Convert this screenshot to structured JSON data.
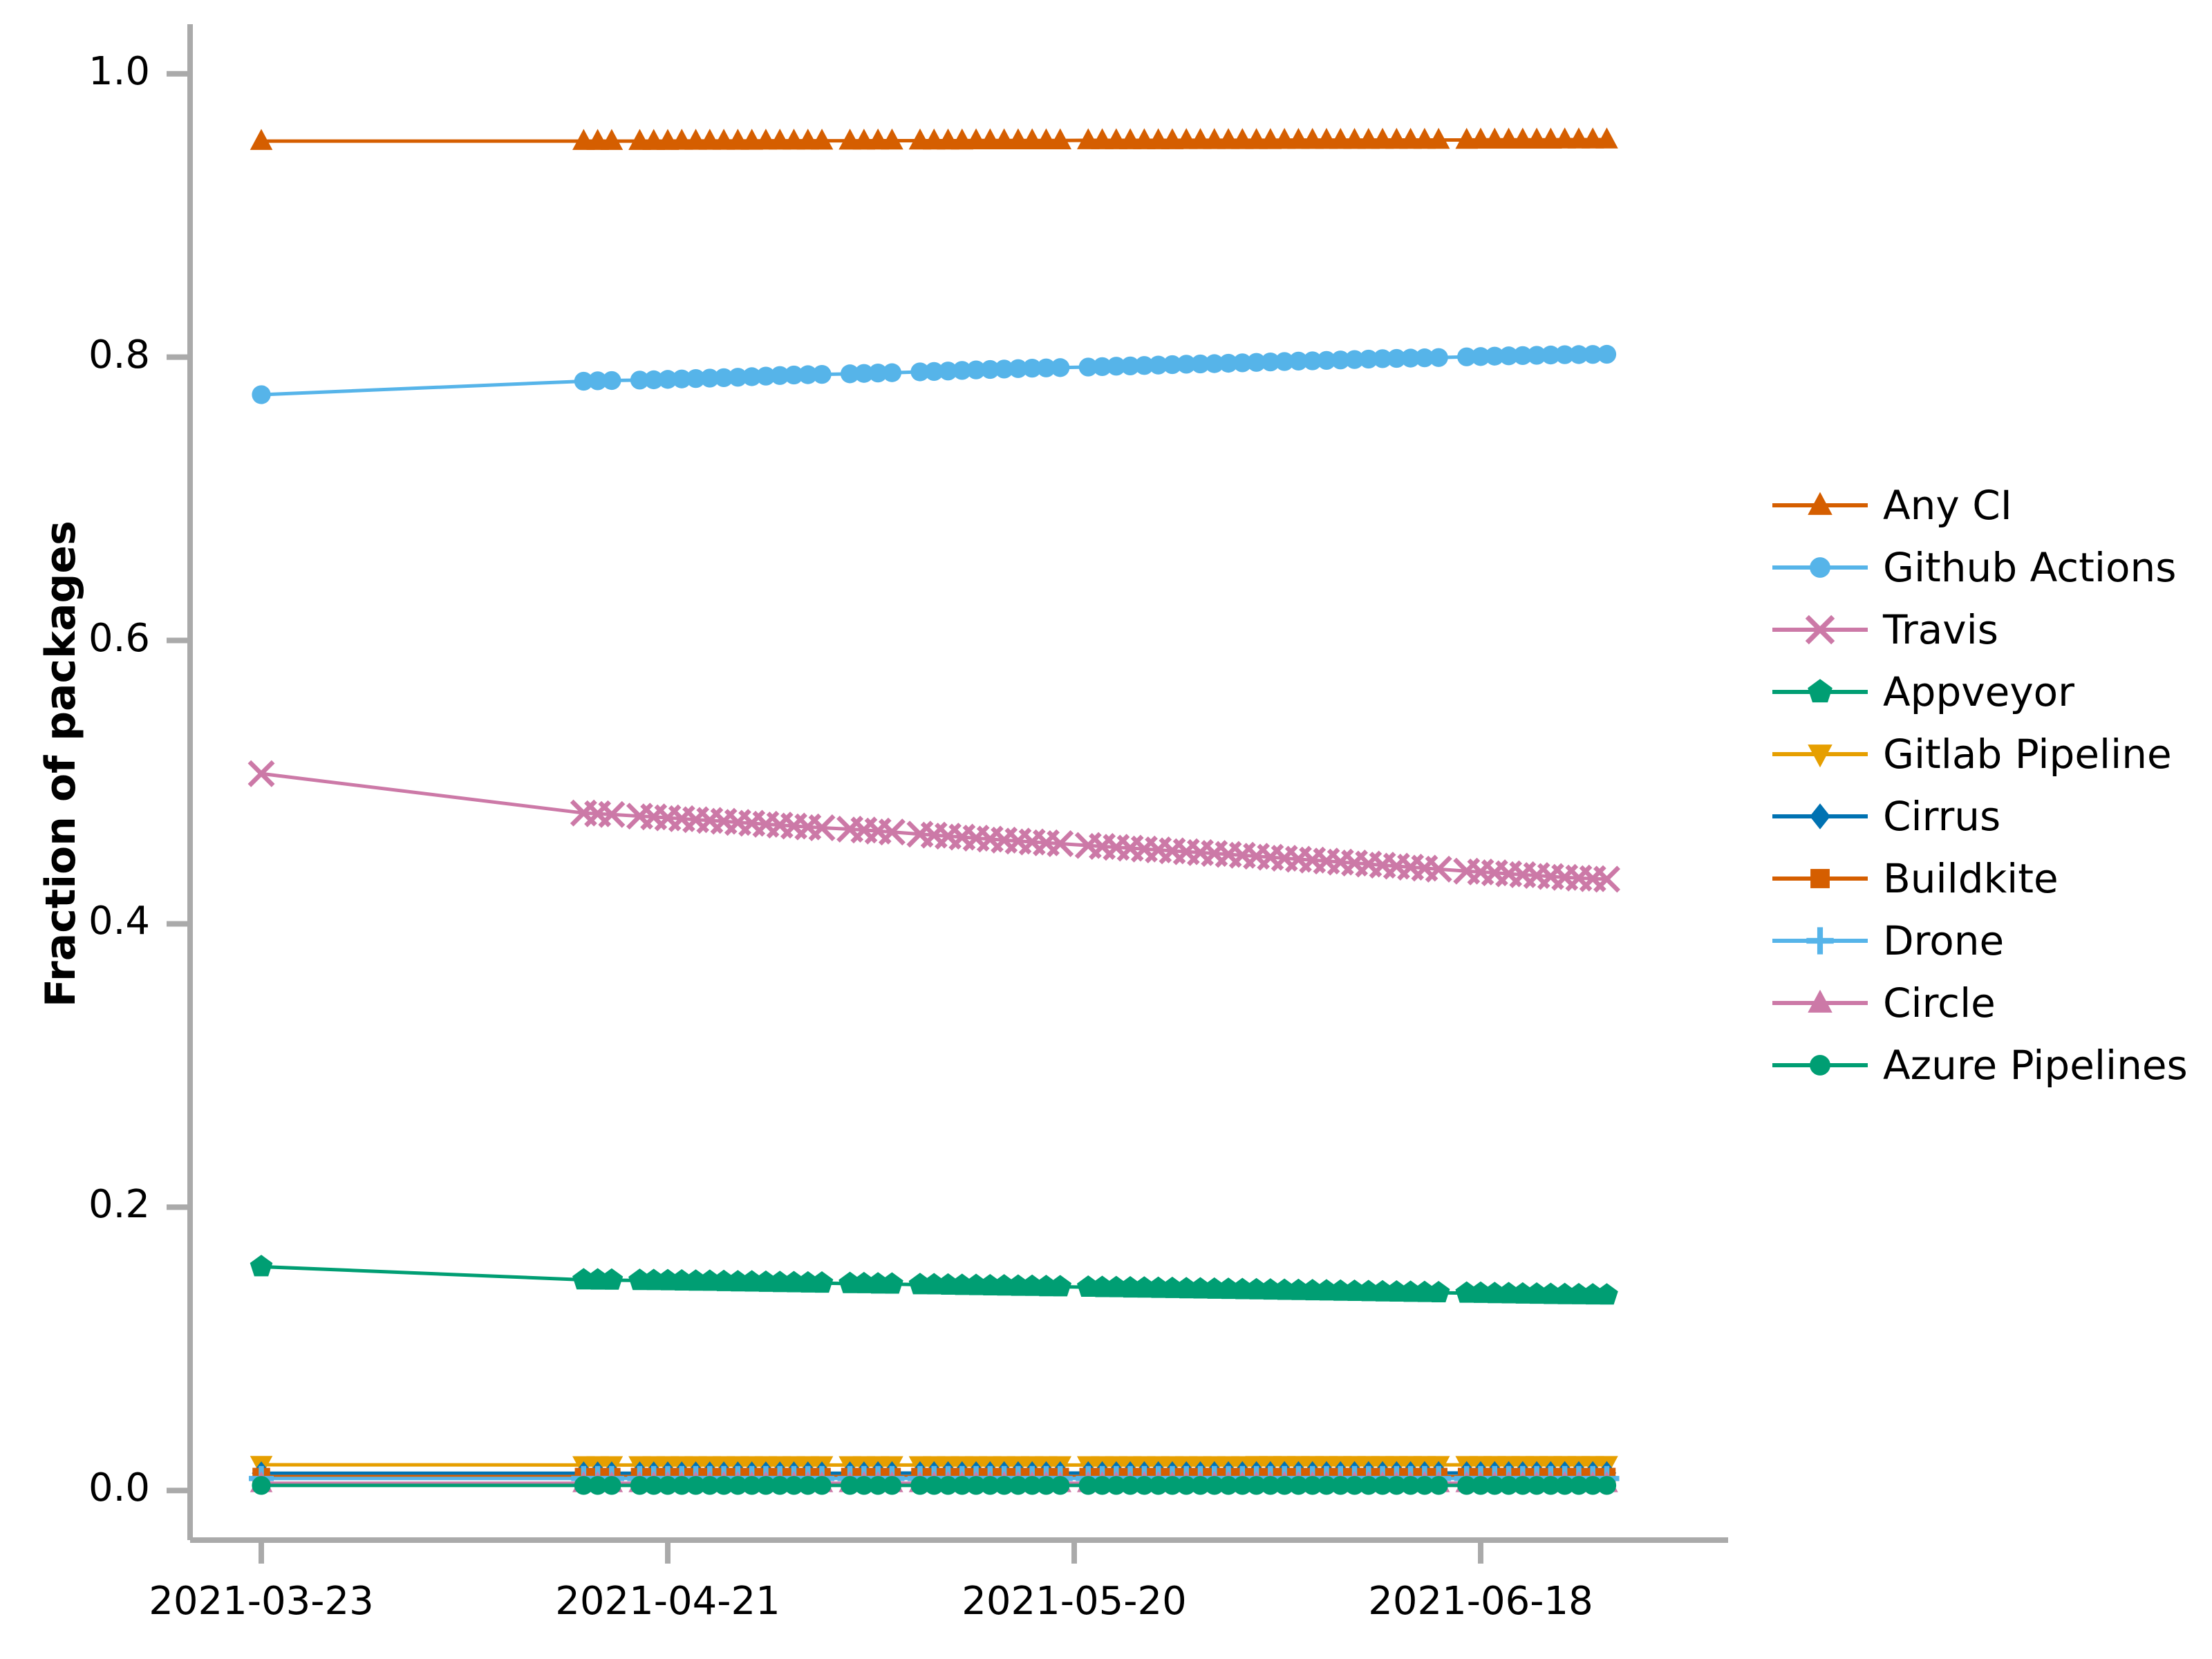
{
  "chart_data": {
    "type": "line",
    "title": "",
    "subtitle": "",
    "xlabel": "",
    "ylabel": "Fraction of packages",
    "ylim": [
      -0.035,
      1.035
    ],
    "yticks": [
      0.0,
      0.2,
      0.4,
      0.6,
      0.8,
      1.0
    ],
    "ytick_labels": [
      "0.0",
      "0.2",
      "0.4",
      "0.6",
      "0.8",
      "1.0"
    ],
    "xlim": [
      "2021-03-23",
      "2021-06-28"
    ],
    "xticks": [
      "2021-03-23",
      "2021-04-21",
      "2021-05-20",
      "2021-06-18"
    ],
    "xtick_labels": [
      "2021-03-23",
      "2021-04-21",
      "2021-05-20",
      "2021-06-18"
    ],
    "grid": false,
    "legend_position": "right",
    "x": [
      "2021-03-23",
      "2021-04-15",
      "2021-04-16",
      "2021-04-17",
      "2021-04-19",
      "2021-04-20",
      "2021-04-21",
      "2021-04-22",
      "2021-04-23",
      "2021-04-24",
      "2021-04-25",
      "2021-04-26",
      "2021-04-27",
      "2021-04-28",
      "2021-04-29",
      "2021-04-30",
      "2021-05-01",
      "2021-05-02",
      "2021-05-04",
      "2021-05-05",
      "2021-05-06",
      "2021-05-07",
      "2021-05-09",
      "2021-05-10",
      "2021-05-11",
      "2021-05-12",
      "2021-05-13",
      "2021-05-14",
      "2021-05-15",
      "2021-05-16",
      "2021-05-17",
      "2021-05-18",
      "2021-05-19",
      "2021-05-21",
      "2021-05-22",
      "2021-05-23",
      "2021-05-24",
      "2021-05-25",
      "2021-05-26",
      "2021-05-27",
      "2021-05-28",
      "2021-05-29",
      "2021-05-30",
      "2021-05-31",
      "2021-06-01",
      "2021-06-02",
      "2021-06-03",
      "2021-06-04",
      "2021-06-05",
      "2021-06-06",
      "2021-06-07",
      "2021-06-08",
      "2021-06-09",
      "2021-06-10",
      "2021-06-11",
      "2021-06-12",
      "2021-06-13",
      "2021-06-14",
      "2021-06-15",
      "2021-06-17",
      "2021-06-18",
      "2021-06-19",
      "2021-06-20",
      "2021-06-21",
      "2021-06-22",
      "2021-06-23",
      "2021-06-24",
      "2021-06-25",
      "2021-06-26",
      "2021-06-27"
    ],
    "series": [
      {
        "name": "Any CI",
        "color": "#D55E00",
        "marker": "triangle-up",
        "values": [
          0.9525,
          0.9525,
          0.9525,
          0.9525,
          0.9525,
          0.9525,
          0.9525,
          0.9526,
          0.9526,
          0.9526,
          0.9526,
          0.9526,
          0.9526,
          0.9527,
          0.9527,
          0.9527,
          0.9527,
          0.9527,
          0.9527,
          0.9527,
          0.9528,
          0.9528,
          0.9528,
          0.9528,
          0.9528,
          0.9528,
          0.9529,
          0.9529,
          0.9529,
          0.9529,
          0.9529,
          0.9529,
          0.9529,
          0.953,
          0.953,
          0.953,
          0.953,
          0.953,
          0.953,
          0.953,
          0.9531,
          0.9531,
          0.9531,
          0.9531,
          0.9531,
          0.9531,
          0.9531,
          0.9532,
          0.9532,
          0.9532,
          0.9532,
          0.9532,
          0.9532,
          0.9532,
          0.9533,
          0.9533,
          0.9533,
          0.9533,
          0.9533,
          0.9533,
          0.9534,
          0.9534,
          0.9534,
          0.9534,
          0.9534,
          0.9534,
          0.9535,
          0.9535,
          0.9535,
          0.9535
        ]
      },
      {
        "name": "Github Actions",
        "color": "#56B4E9",
        "marker": "circle",
        "values": [
          0.7735,
          0.783,
          0.7833,
          0.7835,
          0.7838,
          0.784,
          0.7843,
          0.7846,
          0.7849,
          0.7852,
          0.7855,
          0.7858,
          0.7862,
          0.7866,
          0.787,
          0.7874,
          0.7876,
          0.7878,
          0.7882,
          0.7885,
          0.7888,
          0.789,
          0.7896,
          0.7899,
          0.7902,
          0.7906,
          0.791,
          0.7913,
          0.7916,
          0.7919,
          0.7922,
          0.7924,
          0.7926,
          0.793,
          0.7933,
          0.7936,
          0.7938,
          0.7941,
          0.7944,
          0.7947,
          0.795,
          0.7952,
          0.7954,
          0.7957,
          0.796,
          0.7963,
          0.7966,
          0.7969,
          0.7972,
          0.7974,
          0.7977,
          0.798,
          0.7983,
          0.7986,
          0.7989,
          0.7991,
          0.7993,
          0.7995,
          0.7997,
          0.8002,
          0.8004,
          0.8007,
          0.8009,
          0.8011,
          0.8013,
          0.8015,
          0.8017,
          0.8018,
          0.8019,
          0.802
        ]
      },
      {
        "name": "Travis",
        "color": "#CC79A7",
        "marker": "x",
        "values": [
          0.506,
          0.4782,
          0.4777,
          0.4772,
          0.476,
          0.4755,
          0.4748,
          0.4742,
          0.4735,
          0.473,
          0.4724,
          0.4716,
          0.471,
          0.4703,
          0.4697,
          0.469,
          0.4684,
          0.4678,
          0.4668,
          0.4662,
          0.4655,
          0.4648,
          0.4633,
          0.4626,
          0.4619,
          0.4612,
          0.4605,
          0.4598,
          0.4591,
          0.4584,
          0.4578,
          0.4572,
          0.4566,
          0.4553,
          0.4546,
          0.454,
          0.4534,
          0.4528,
          0.4522,
          0.4515,
          0.4509,
          0.4503,
          0.4497,
          0.449,
          0.4484,
          0.4477,
          0.447,
          0.4463,
          0.4456,
          0.445,
          0.4443,
          0.4436,
          0.4429,
          0.4422,
          0.4414,
          0.4407,
          0.44,
          0.4393,
          0.4386,
          0.4372,
          0.4366,
          0.436,
          0.4353,
          0.4347,
          0.4341,
          0.4334,
          0.4328,
          0.4323,
          0.4319,
          0.4315
        ]
      },
      {
        "name": "Appveyor",
        "color": "#009E73",
        "marker": "pentagon",
        "values": [
          0.158,
          0.1487,
          0.1486,
          0.1485,
          0.1483,
          0.1482,
          0.1481,
          0.1479,
          0.1478,
          0.1477,
          0.1475,
          0.1473,
          0.1472,
          0.147,
          0.1468,
          0.1467,
          0.1465,
          0.1464,
          0.1461,
          0.146,
          0.1458,
          0.1457,
          0.1453,
          0.1452,
          0.145,
          0.1448,
          0.1447,
          0.1445,
          0.1444,
          0.1442,
          0.1441,
          0.1439,
          0.1438,
          0.1435,
          0.1433,
          0.1432,
          0.143,
          0.1429,
          0.1427,
          0.1426,
          0.1424,
          0.1423,
          0.1421,
          0.142,
          0.1418,
          0.1417,
          0.1415,
          0.1413,
          0.1412,
          0.141,
          0.1409,
          0.1407,
          0.1406,
          0.1404,
          0.1402,
          0.1401,
          0.1399,
          0.1398,
          0.1396,
          0.1393,
          0.1392,
          0.139,
          0.1389,
          0.1387,
          0.1386,
          0.1384,
          0.1383,
          0.1382,
          0.1381,
          0.138
        ]
      },
      {
        "name": "Gitlab Pipeline",
        "color": "#E69F00",
        "marker": "triangle-down",
        "values": [
          0.0182,
          0.018,
          0.018,
          0.018,
          0.018,
          0.018,
          0.018,
          0.018,
          0.018,
          0.018,
          0.018,
          0.018,
          0.018,
          0.018,
          0.018,
          0.018,
          0.018,
          0.018,
          0.018,
          0.018,
          0.018,
          0.018,
          0.018,
          0.018,
          0.018,
          0.018,
          0.018,
          0.018,
          0.018,
          0.018,
          0.018,
          0.018,
          0.018,
          0.018,
          0.018,
          0.018,
          0.018,
          0.018,
          0.018,
          0.018,
          0.018,
          0.018,
          0.018,
          0.018,
          0.018,
          0.0181,
          0.0181,
          0.0181,
          0.0181,
          0.0181,
          0.0181,
          0.0181,
          0.0181,
          0.0181,
          0.0181,
          0.0181,
          0.0181,
          0.0181,
          0.0181,
          0.0181,
          0.0181,
          0.0181,
          0.0181,
          0.0181,
          0.0181,
          0.0181,
          0.0181,
          0.0181,
          0.0181,
          0.0181
        ]
      },
      {
        "name": "Cirrus",
        "color": "#0072B2",
        "marker": "diamond",
        "values": [
          0.0122,
          0.0122,
          0.0122,
          0.0122,
          0.0122,
          0.0122,
          0.0122,
          0.0122,
          0.0122,
          0.0122,
          0.0122,
          0.0122,
          0.0122,
          0.0122,
          0.0122,
          0.0122,
          0.0122,
          0.0122,
          0.0122,
          0.0122,
          0.0123,
          0.0123,
          0.0123,
          0.0123,
          0.0123,
          0.0123,
          0.0123,
          0.0123,
          0.0123,
          0.0123,
          0.0123,
          0.0123,
          0.0123,
          0.0123,
          0.0123,
          0.0123,
          0.0123,
          0.0123,
          0.0123,
          0.0123,
          0.0123,
          0.0123,
          0.0123,
          0.0123,
          0.0124,
          0.0124,
          0.0124,
          0.0124,
          0.0124,
          0.0124,
          0.0124,
          0.0124,
          0.0124,
          0.0124,
          0.0124,
          0.0124,
          0.0124,
          0.0124,
          0.0124,
          0.0124,
          0.0124,
          0.0124,
          0.0124,
          0.0124,
          0.0124,
          0.0124,
          0.0124,
          0.0124,
          0.0124,
          0.0124
        ]
      },
      {
        "name": "Buildkite",
        "color": "#D55E00",
        "marker": "square",
        "values": [
          0.0098,
          0.0098,
          0.0098,
          0.0098,
          0.0098,
          0.0098,
          0.0098,
          0.0098,
          0.0098,
          0.0098,
          0.0098,
          0.0098,
          0.0098,
          0.0098,
          0.0098,
          0.0098,
          0.0098,
          0.0098,
          0.0098,
          0.0098,
          0.0098,
          0.0098,
          0.0098,
          0.0098,
          0.0098,
          0.0098,
          0.0098,
          0.0098,
          0.0098,
          0.0098,
          0.0098,
          0.0098,
          0.0098,
          0.0098,
          0.0098,
          0.0098,
          0.0098,
          0.0098,
          0.0098,
          0.0098,
          0.0098,
          0.0098,
          0.0098,
          0.0098,
          0.0098,
          0.0098,
          0.0098,
          0.0098,
          0.0098,
          0.0098,
          0.0098,
          0.0098,
          0.0098,
          0.0098,
          0.0098,
          0.0098,
          0.0098,
          0.0098,
          0.0098,
          0.0098,
          0.0098,
          0.0098,
          0.0098,
          0.0098,
          0.0098,
          0.0098,
          0.0098,
          0.0098,
          0.0098,
          0.0098
        ]
      },
      {
        "name": "Drone",
        "color": "#56B4E9",
        "marker": "plus",
        "values": [
          0.0085,
          0.0085,
          0.0085,
          0.0085,
          0.0085,
          0.0085,
          0.0085,
          0.0085,
          0.0085,
          0.0085,
          0.0085,
          0.0085,
          0.0085,
          0.0085,
          0.0085,
          0.0085,
          0.0085,
          0.0085,
          0.0085,
          0.0085,
          0.0085,
          0.0085,
          0.0085,
          0.0085,
          0.0085,
          0.0085,
          0.0085,
          0.0085,
          0.0085,
          0.0085,
          0.0085,
          0.0085,
          0.0085,
          0.0085,
          0.0085,
          0.0085,
          0.0085,
          0.0085,
          0.0085,
          0.0085,
          0.0085,
          0.0085,
          0.0085,
          0.0085,
          0.0085,
          0.0085,
          0.0085,
          0.0085,
          0.0085,
          0.0085,
          0.0085,
          0.0085,
          0.0085,
          0.0085,
          0.0085,
          0.0085,
          0.0085,
          0.0085,
          0.0085,
          0.0085,
          0.0085,
          0.0085,
          0.0085,
          0.0085,
          0.0085,
          0.0085,
          0.0085,
          0.0085,
          0.0085,
          0.0085
        ]
      },
      {
        "name": "Circle",
        "color": "#CC79A7",
        "marker": "triangle-up",
        "values": [
          0.0051,
          0.0051,
          0.0051,
          0.0051,
          0.0051,
          0.0051,
          0.0051,
          0.0051,
          0.0051,
          0.0051,
          0.0051,
          0.0051,
          0.0051,
          0.0051,
          0.0051,
          0.0051,
          0.0051,
          0.0051,
          0.0051,
          0.0051,
          0.0051,
          0.0051,
          0.0051,
          0.0051,
          0.0051,
          0.0051,
          0.0051,
          0.0051,
          0.0051,
          0.0051,
          0.0051,
          0.0051,
          0.0051,
          0.0051,
          0.0051,
          0.0051,
          0.0051,
          0.0051,
          0.0051,
          0.0051,
          0.0051,
          0.0051,
          0.0051,
          0.0051,
          0.0051,
          0.0051,
          0.0051,
          0.0051,
          0.0051,
          0.0051,
          0.0051,
          0.0051,
          0.0051,
          0.0051,
          0.0051,
          0.0051,
          0.0051,
          0.0051,
          0.0051,
          0.0051,
          0.0051,
          0.0051,
          0.0051,
          0.0051,
          0.0051,
          0.0051,
          0.0051,
          0.0051,
          0.0051,
          0.0051
        ]
      },
      {
        "name": "Azure Pipelines",
        "color": "#009E73",
        "marker": "circle",
        "values": [
          0.0036,
          0.0036,
          0.0036,
          0.0036,
          0.0036,
          0.0036,
          0.0036,
          0.0036,
          0.0036,
          0.0036,
          0.0036,
          0.0036,
          0.0036,
          0.0036,
          0.0036,
          0.0036,
          0.0036,
          0.0036,
          0.0036,
          0.0036,
          0.0036,
          0.0036,
          0.0036,
          0.0036,
          0.0036,
          0.0036,
          0.0036,
          0.0036,
          0.0036,
          0.0036,
          0.0036,
          0.0036,
          0.0036,
          0.0036,
          0.0036,
          0.0036,
          0.0036,
          0.0036,
          0.0036,
          0.0036,
          0.0036,
          0.0036,
          0.0036,
          0.0036,
          0.0036,
          0.0036,
          0.0036,
          0.0036,
          0.0036,
          0.0036,
          0.0036,
          0.0036,
          0.0036,
          0.0036,
          0.0036,
          0.0036,
          0.0036,
          0.0036,
          0.0036,
          0.0036,
          0.0036,
          0.0036,
          0.0036,
          0.0036,
          0.0036,
          0.0036,
          0.0036,
          0.0036,
          0.0036,
          0.0036
        ]
      }
    ]
  },
  "axes": {
    "spine_color": "#AAAAAA",
    "tick_color": "#AAAAAA",
    "text_color": "#000000"
  }
}
